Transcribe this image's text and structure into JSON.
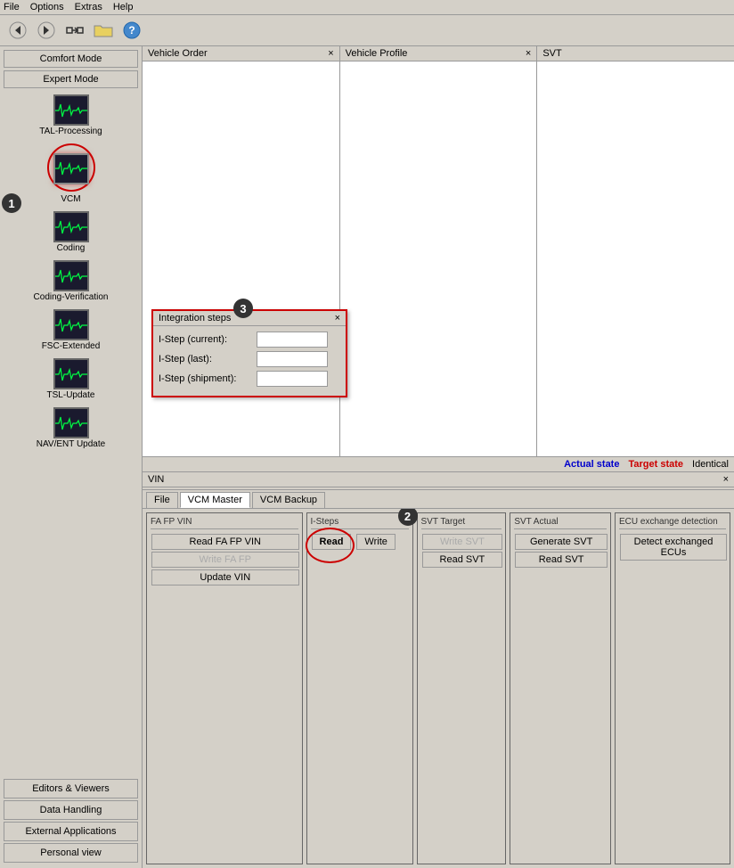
{
  "menubar": {
    "items": [
      "File",
      "Options",
      "Extras",
      "Help"
    ]
  },
  "toolbar": {
    "back_icon": "◀",
    "forward_icon": "▶",
    "network_icon": "⇄",
    "folder_icon": "📁",
    "help_icon": "?"
  },
  "sidebar": {
    "comfort_mode": "Comfort Mode",
    "expert_mode": "Expert Mode",
    "items": [
      {
        "id": "tal-processing",
        "label": "TAL-Processing"
      },
      {
        "id": "vcm",
        "label": "VCM",
        "selected": true
      },
      {
        "id": "coding",
        "label": "Coding"
      },
      {
        "id": "coding-verification",
        "label": "Coding-Verification"
      },
      {
        "id": "fsc-extended",
        "label": "FSC-Extended"
      },
      {
        "id": "tsl-update",
        "label": "TSL-Update"
      },
      {
        "id": "nav-ent-update",
        "label": "NAV/ENT Update"
      }
    ],
    "bottom_items": [
      {
        "id": "editors-viewers",
        "label": "Editors & Viewers"
      },
      {
        "id": "data-handling",
        "label": "Data Handling"
      },
      {
        "id": "external-applications",
        "label": "External Applications",
        "active": false
      },
      {
        "id": "personal-view",
        "label": "Personal view"
      }
    ]
  },
  "panels": {
    "vehicle_order": {
      "title": "Vehicle Order",
      "close": "×"
    },
    "vehicle_profile": {
      "title": "Vehicle Profile",
      "close": "×"
    },
    "svt": {
      "title": "SVT"
    }
  },
  "status": {
    "actual": "Actual state",
    "target": "Target state",
    "identical": "Identical"
  },
  "vin_panel": {
    "title": "VIN",
    "close": "×"
  },
  "tabs": {
    "file": "File",
    "vcm_master": "VCM Master",
    "vcm_backup": "VCM Backup"
  },
  "fa_fp_vin": {
    "title": "FA FP VIN",
    "read_fa_fp_vin": "Read FA FP VIN",
    "write_fa_fp": "Write FA FP",
    "update_vin": "Update VIN"
  },
  "isteps": {
    "title": "I-Steps",
    "read": "Read",
    "write": "Write"
  },
  "integration_steps": {
    "title": "Integration steps",
    "close": "×",
    "current_label": "I-Step (current):",
    "last_label": "I-Step (last):",
    "shipment_label": "I-Step (shipment):",
    "current_value": "",
    "last_value": "",
    "shipment_value": ""
  },
  "svt_target": {
    "title": "SVT Target",
    "write_svt": "Write SVT",
    "read_svt": "Read SVT"
  },
  "svt_actual": {
    "title": "SVT Actual",
    "generate_svt": "Generate SVT",
    "read_svt": "Read SVT"
  },
  "ecu_exchange": {
    "title": "ECU exchange detection",
    "detect": "Detect exchanged ECUs"
  },
  "badges": {
    "one": "1",
    "two": "2",
    "three": "3"
  }
}
